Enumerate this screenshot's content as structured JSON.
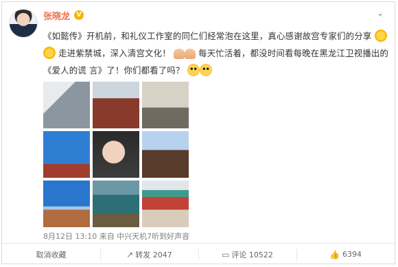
{
  "post": {
    "author": "张晓龙",
    "text_line1": "《如懿传》开机前，和礼仪工作室的同仁们经常泡在这里，真心感谢故宫专家们的分享",
    "text_line2a": "走进紫禁城，深入清宫文化！",
    "text_line2b": "每天忙活着，都没时间看每晚在黑龙江卫视播出的《爱人的谎",
    "text_line3": "言》了！你们都看了吗？",
    "meta": "8月12日 13:10 来自 中兴天机7听到好声音"
  },
  "actions": {
    "collect": "取消收藏",
    "repost": "转发 2047",
    "comment": "评论 10522",
    "like": "6394"
  },
  "icons": {
    "vip": "vip-badge-icon",
    "menu": "chevron-down-icon",
    "like": "thumb-up-icon"
  }
}
